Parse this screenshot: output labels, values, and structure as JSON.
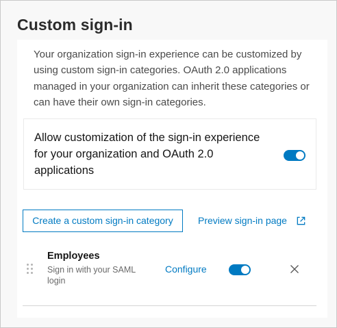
{
  "panel": {
    "title": "Custom sign-in",
    "description": "Your organization sign-in experience can be customized by using custom sign-in categories. OAuth 2.0 applications managed in your organization can inherit these categories or can have their own sign-in categories."
  },
  "setting": {
    "label": "Allow customization of the sign-in experience for your organization and OAuth 2.0 applications",
    "enabled": true
  },
  "actions": {
    "create_label": "Create a custom sign-in category",
    "preview_label": "Preview sign-in page"
  },
  "categories": [
    {
      "name": "Employees",
      "description": "Sign in with your SAML login",
      "configure_label": "Configure",
      "enabled": true
    }
  ],
  "colors": {
    "accent": "#007ac2",
    "panel_background": "#f8f8f8",
    "border": "#c9c9c9"
  },
  "icons": {
    "external": "external-link-icon",
    "drag": "drag-handle-icon",
    "close": "close-icon"
  }
}
